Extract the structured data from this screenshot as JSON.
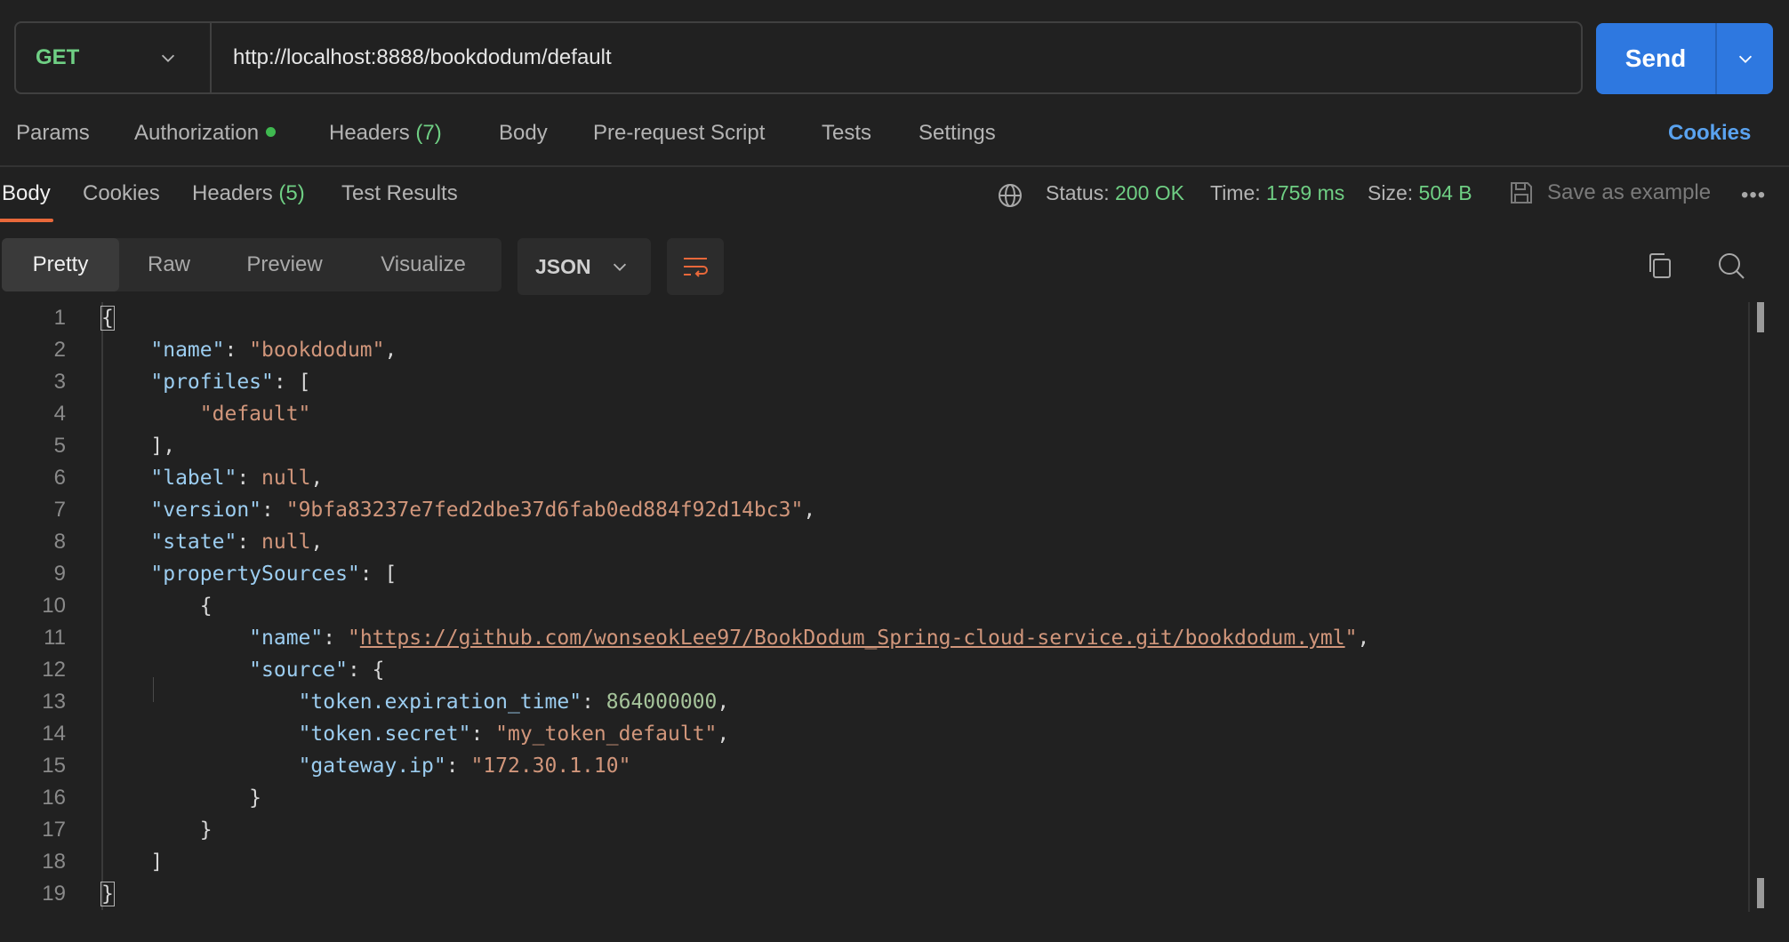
{
  "request": {
    "method": "GET",
    "url": "http://localhost:8888/bookdodum/default",
    "send_label": "Send"
  },
  "request_tabs": {
    "params": "Params",
    "authorization": "Authorization",
    "headers": "Headers",
    "headers_count": "(7)",
    "body": "Body",
    "prerequest": "Pre-request Script",
    "tests": "Tests",
    "settings": "Settings",
    "cookies": "Cookies"
  },
  "response_tabs": {
    "body": "Body",
    "cookies": "Cookies",
    "headers": "Headers",
    "headers_count": "(5)",
    "test_results": "Test Results"
  },
  "response_meta": {
    "status_label": "Status:",
    "status_value": "200 OK",
    "time_label": "Time:",
    "time_value": "1759 ms",
    "size_label": "Size:",
    "size_value": "504 B",
    "save_example": "Save as example"
  },
  "view": {
    "pretty": "Pretty",
    "raw": "Raw",
    "preview": "Preview",
    "visualize": "Visualize",
    "format": "JSON"
  },
  "code": {
    "line_numbers": [
      "1",
      "2",
      "3",
      "4",
      "5",
      "6",
      "7",
      "8",
      "9",
      "10",
      "11",
      "12",
      "13",
      "14",
      "15",
      "16",
      "17",
      "18",
      "19"
    ],
    "name_key": "\"name\"",
    "name_value": "\"bookdodum\"",
    "profiles_key": "\"profiles\"",
    "profile_0": "\"default\"",
    "label_key": "\"label\"",
    "label_value": "null",
    "version_key": "\"version\"",
    "version_value": "\"9bfa83237e7fed2dbe37d6fab0ed884f92d14bc3\"",
    "state_key": "\"state\"",
    "state_value": "null",
    "property_sources_key": "\"propertySources\"",
    "ps_name_key": "\"name\"",
    "ps_name_url": "https://github.com/wonseokLee97/BookDodum_Spring-cloud-service.git/bookdodum.yml",
    "source_key": "\"source\"",
    "token_exp_key": "\"token.expiration_time\"",
    "token_exp_value": "864000000",
    "token_secret_key": "\"token.secret\"",
    "token_secret_value": "\"my_token_default\"",
    "gateway_key": "\"gateway.ip\"",
    "gateway_value": "\"172.30.1.10\""
  },
  "colors": {
    "accent": "#2e78e0",
    "success": "#6fcf84",
    "active_tab_underline": "#e8683a",
    "cookies_link": "#5aa3f0"
  },
  "icons": [
    "chevron-down-icon",
    "globe-icon",
    "save-icon",
    "more-icon",
    "wrap-lines-icon",
    "copy-icon",
    "search-icon"
  ]
}
